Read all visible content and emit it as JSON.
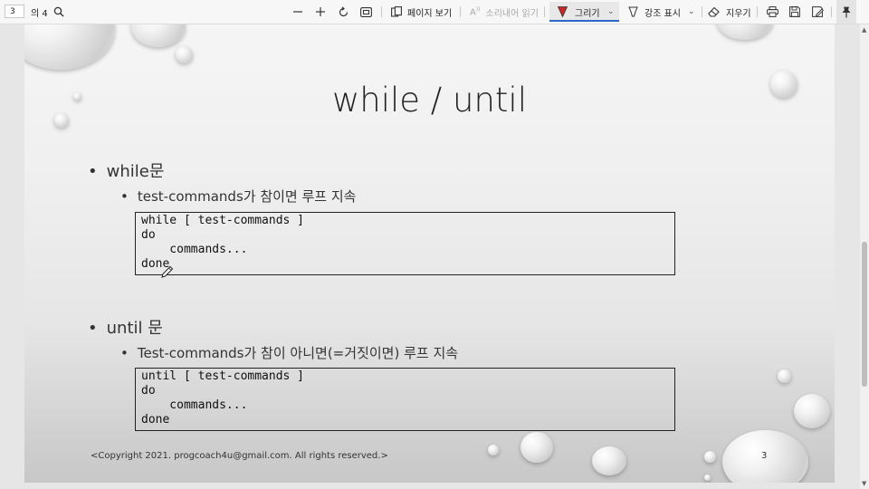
{
  "toolbar": {
    "page_current": "3",
    "page_total": "의 4",
    "page_view_label": "페이지 보기",
    "read_aloud_label": "소리내어 읽기",
    "draw_label": "그리기",
    "highlight_label": "강조 표시",
    "erase_label": "지우기",
    "draw_color": "#c62828",
    "active_accent": "#2b67c6",
    "icons": [
      "search-icon",
      "zoom-out-icon",
      "zoom-in-icon",
      "rotate-icon",
      "fit-page-icon",
      "page-view-icon",
      "read-aloud-icon",
      "draw-icon",
      "highlight-icon",
      "erase-icon",
      "print-icon",
      "save-icon",
      "save-as-icon",
      "pin-icon"
    ]
  },
  "slide": {
    "title": "while / until",
    "sections": [
      {
        "heading": "while문",
        "sub": "test-commands가 참이면 루프 지속",
        "code": [
          "while [ test-commands ]",
          "do",
          "    commands...",
          "done"
        ]
      },
      {
        "heading": "until 문",
        "sub": "Test-commands가 참이 아니면(=거짓이면) 루프 지속",
        "code": [
          "until [ test-commands ]",
          "do",
          "    commands...",
          "done"
        ]
      }
    ],
    "footer": "<Copyright 2021. progcoach4u@gmail.com. All rights reserved.>",
    "page_number": "3"
  }
}
